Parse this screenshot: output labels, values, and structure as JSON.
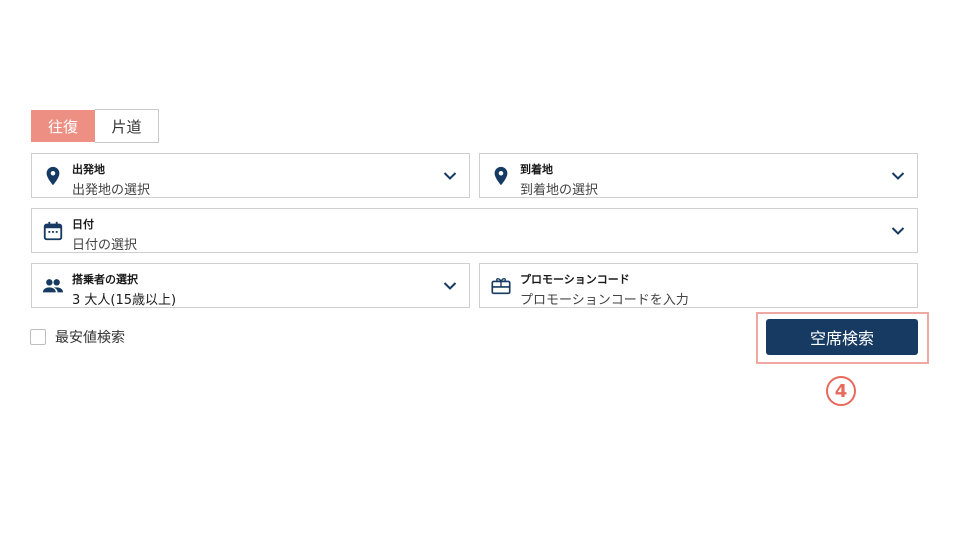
{
  "trip_tabs": [
    {
      "label": "往復",
      "active": true
    },
    {
      "label": "片道",
      "active": false
    }
  ],
  "departure": {
    "label": "出発地",
    "placeholder": "出発地の選択",
    "icon": "location-pin-icon"
  },
  "arrival": {
    "label": "到着地",
    "placeholder": "到着地の選択",
    "icon": "location-pin-icon"
  },
  "date": {
    "label": "日付",
    "placeholder": "日付の選択",
    "icon": "calendar-icon"
  },
  "passengers": {
    "label": "搭乗者の選択",
    "value": "3 大人(15歳以上)",
    "icon": "people-icon"
  },
  "promo": {
    "label": "プロモーションコード",
    "placeholder": "プロモーションコードを入力",
    "icon": "gift-card-icon"
  },
  "lowest_fare": {
    "label": "最安値検索",
    "checked": false
  },
  "search_button": {
    "label": "空席検索"
  },
  "step_marker": {
    "label": "4"
  },
  "colors": {
    "accent": "#ee8f84",
    "primary": "#163a61",
    "highlight": "#f0a9a2",
    "marker": "#e76a5c"
  }
}
